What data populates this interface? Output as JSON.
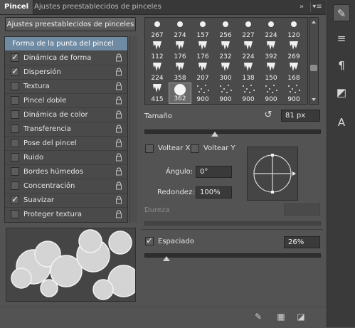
{
  "tabs": [
    {
      "label": "Pincel",
      "active": true
    },
    {
      "label": "Ajustes preestablecidos de pinceles",
      "active": false
    }
  ],
  "tabbar_icons": [
    "collapse-icon",
    "panel-menu-icon"
  ],
  "preset_button": "Ajustes preestablecidos de pinceles",
  "options_list": [
    {
      "label": "Forma de la punta del pincel",
      "selected": true,
      "checkbox": false
    },
    {
      "label": "Dinámica de forma",
      "checked": true,
      "checkbox": true
    },
    {
      "label": "Dispersión",
      "checked": true,
      "checkbox": true
    },
    {
      "label": "Textura",
      "checked": false,
      "checkbox": true
    },
    {
      "label": "Pincel doble",
      "checked": false,
      "checkbox": true
    },
    {
      "label": "Dinámica de color",
      "checked": false,
      "checkbox": true
    },
    {
      "label": "Transferencia",
      "checked": false,
      "checkbox": true
    },
    {
      "label": "Pose del pincel",
      "checked": false,
      "checkbox": true
    },
    {
      "label": "Ruido",
      "checked": false,
      "checkbox": true
    },
    {
      "label": "Bordes húmedos",
      "checked": false,
      "checkbox": true
    },
    {
      "label": "Concentración",
      "checked": false,
      "checkbox": true
    },
    {
      "label": "Suavizar",
      "checked": true,
      "checkbox": true
    },
    {
      "label": "Proteger textura",
      "checked": false,
      "checkbox": true
    }
  ],
  "brush_grid": [
    {
      "size": "267",
      "style": "hard"
    },
    {
      "size": "274",
      "style": "hard"
    },
    {
      "size": "157",
      "style": "hard"
    },
    {
      "size": "256",
      "style": "hard"
    },
    {
      "size": "227",
      "style": "hard"
    },
    {
      "size": "224",
      "style": "hard"
    },
    {
      "size": "120",
      "style": "hard"
    },
    {
      "size": "112",
      "style": "drip"
    },
    {
      "size": "176",
      "style": "drip"
    },
    {
      "size": "176",
      "style": "drip"
    },
    {
      "size": "232",
      "style": "drip"
    },
    {
      "size": "224",
      "style": "drip"
    },
    {
      "size": "392",
      "style": "drip"
    },
    {
      "size": "269",
      "style": "drip"
    },
    {
      "size": "224",
      "style": "drip"
    },
    {
      "size": "358",
      "style": "drip"
    },
    {
      "size": "207",
      "style": "drip"
    },
    {
      "size": "300",
      "style": "drip"
    },
    {
      "size": "138",
      "style": "drip"
    },
    {
      "size": "150",
      "style": "drip"
    },
    {
      "size": "168",
      "style": "drip"
    },
    {
      "size": "415",
      "style": "drip"
    },
    {
      "size": "362",
      "style": "round",
      "selected": true
    },
    {
      "size": "900",
      "style": "speckle"
    },
    {
      "size": "900",
      "style": "speckle"
    },
    {
      "size": "900",
      "style": "speckle"
    },
    {
      "size": "900",
      "style": "speckle"
    },
    {
      "size": "900",
      "style": "speckle"
    }
  ],
  "size": {
    "label": "Tamaño",
    "value": "81 px",
    "slider_fraction": 0.405
  },
  "flip": {
    "x_label": "Voltear X",
    "y_label": "Voltear Y",
    "x_checked": false,
    "y_checked": false
  },
  "angle": {
    "label": "Ángulo:",
    "value": "0°"
  },
  "roundness": {
    "label": "Redondez:",
    "value": "100%"
  },
  "hardness": {
    "label": "Dureza",
    "value": "",
    "disabled": true
  },
  "spacing": {
    "label": "Espaciado",
    "value": "26%",
    "checked": true,
    "slider_fraction": 0.12
  },
  "bottom_icons": [
    "brush-toggle-icon",
    "grid-icon",
    "new-preset-icon"
  ],
  "dock_buttons": [
    {
      "name": "brush-panel-icon",
      "glyph": "✎",
      "active": true
    },
    {
      "name": "sliders-panel-icon",
      "glyph": "≡",
      "active": false
    },
    {
      "name": "paragraph-panel-icon",
      "glyph": "¶",
      "active": false
    },
    {
      "name": "3d-cube-icon",
      "glyph": "◩",
      "active": false
    },
    {
      "name": "character-panel-icon",
      "glyph": "A",
      "active": false
    }
  ],
  "colors": {
    "selected_row": "#6f8aa3",
    "panel": "#535353",
    "field": "#3a3a3a"
  }
}
